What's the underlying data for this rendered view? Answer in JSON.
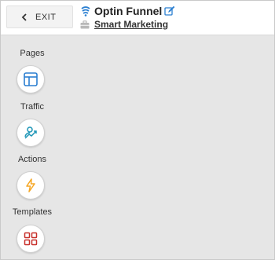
{
  "header": {
    "exit_label": "EXIT",
    "funnel_title": "Optin Funnel",
    "workspace": "Smart Marketing"
  },
  "sidebar": {
    "items": [
      {
        "label": "Pages",
        "icon": "layout-icon",
        "color": "#2b7fd1"
      },
      {
        "label": "Traffic",
        "icon": "user-growth-icon",
        "color": "#1c95b6"
      },
      {
        "label": "Actions",
        "icon": "lightning-icon",
        "color": "#f5a623"
      },
      {
        "label": "Templates",
        "icon": "grid-icon",
        "color": "#c8302b"
      }
    ]
  },
  "colors": {
    "background": "#e6e6e6",
    "accent_blue": "#2b7fd1"
  }
}
